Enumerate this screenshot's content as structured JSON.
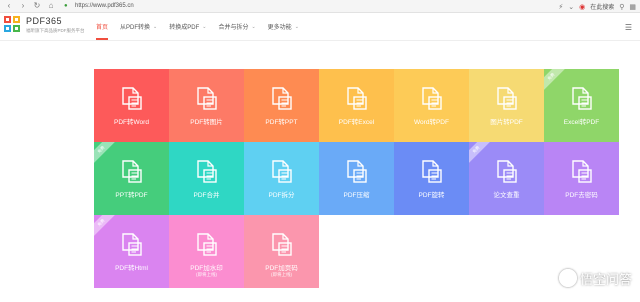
{
  "browser": {
    "url": "https://www.pdf365.cn",
    "right_text": "在此搜索"
  },
  "site": {
    "brand": "PDF365",
    "tagline": "福昕旗下高品质PDF服务平台"
  },
  "nav": {
    "items": [
      {
        "label": "首页",
        "active": true,
        "dropdown": false
      },
      {
        "label": "从PDF转换",
        "active": false,
        "dropdown": true
      },
      {
        "label": "转换成PDF",
        "active": false,
        "dropdown": true
      },
      {
        "label": "合并与拆分",
        "active": false,
        "dropdown": true
      },
      {
        "label": "更多功能",
        "active": false,
        "dropdown": true
      }
    ]
  },
  "tools": [
    {
      "label": "PDF转Word",
      "color": "#fd5a5a",
      "icon": "pdf-to-word-icon"
    },
    {
      "label": "PDF转图片",
      "color": "#fd7a66",
      "icon": "pdf-to-image-icon"
    },
    {
      "label": "PDF转PPT",
      "color": "#fe8b52",
      "icon": "pdf-to-ppt-icon"
    },
    {
      "label": "PDF转Excel",
      "color": "#fec04d",
      "icon": "pdf-to-excel-icon"
    },
    {
      "label": "Word转PDF",
      "color": "#fdcb57",
      "icon": "word-to-pdf-icon"
    },
    {
      "label": "图片转PDF",
      "color": "#f6da73",
      "icon": "image-to-pdf-icon"
    },
    {
      "label": "Excel转PDF",
      "color": "#8fd669",
      "icon": "excel-to-pdf-icon",
      "ribbon": "免费"
    },
    {
      "label": "PPT转PDF",
      "color": "#45cd7c",
      "icon": "ppt-to-pdf-icon",
      "ribbon": "免费"
    },
    {
      "label": "PDF合并",
      "color": "#2fd7c4",
      "icon": "pdf-merge-icon"
    },
    {
      "label": "PDF拆分",
      "color": "#5fd0f2",
      "icon": "pdf-split-icon"
    },
    {
      "label": "PDF压缩",
      "color": "#6aaaf7",
      "icon": "pdf-compress-icon"
    },
    {
      "label": "PDF旋转",
      "color": "#6b8cf5",
      "icon": "pdf-rotate-icon"
    },
    {
      "label": "论文查重",
      "color": "#9b8bf7",
      "icon": "paper-check-icon",
      "ribbon": "免费"
    },
    {
      "label": "PDF去密码",
      "color": "#b985f5",
      "icon": "pdf-unlock-icon"
    },
    {
      "label": "PDF转Html",
      "color": "#da84f0",
      "icon": "pdf-to-html-icon",
      "ribbon": "免费"
    },
    {
      "label": "PDF加水印",
      "sub": "(即将上线)",
      "color": "#fb8dd0",
      "icon": "pdf-watermark-icon"
    },
    {
      "label": "PDF加页码",
      "sub": "(即将上线)",
      "color": "#fb96ad",
      "icon": "pdf-page-number-icon"
    }
  ],
  "watermark": {
    "text": "悟空问答"
  }
}
